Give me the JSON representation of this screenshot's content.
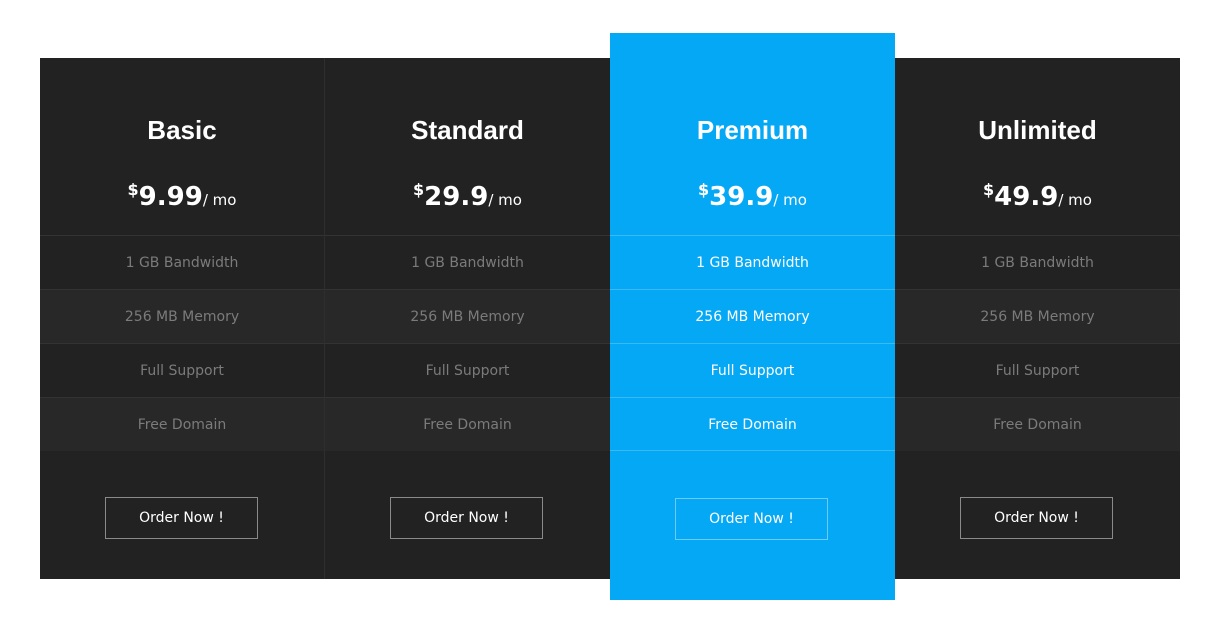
{
  "plans": [
    {
      "name": "Basic",
      "currency": "$",
      "price": "9.99",
      "period": "/ mo",
      "features": [
        "1 GB Bandwidth",
        "256 MB Memory",
        "Full Support",
        "Free Domain"
      ],
      "button_label": "Order Now !",
      "highlighted": false
    },
    {
      "name": "Standard",
      "currency": "$",
      "price": "29.9",
      "period": "/ mo",
      "features": [
        "1 GB Bandwidth",
        "256 MB Memory",
        "Full Support",
        "Free Domain"
      ],
      "button_label": "Order Now !",
      "highlighted": false
    },
    {
      "name": "Premium",
      "currency": "$",
      "price": "39.9",
      "period": "/ mo",
      "features": [
        "1 GB Bandwidth",
        "256 MB Memory",
        "Full Support",
        "Free Domain"
      ],
      "button_label": "Order Now !",
      "highlighted": true
    },
    {
      "name": "Unlimited",
      "currency": "$",
      "price": "49.9",
      "period": "/ mo",
      "features": [
        "1 GB Bandwidth",
        "256 MB Memory",
        "Full Support",
        "Free Domain"
      ],
      "button_label": "Order Now !",
      "highlighted": false
    }
  ],
  "colors": {
    "card_background": "#222222",
    "highlight_background": "#05a8f4",
    "feature_text": "#7b7b7b",
    "page_background": "#ffffff"
  }
}
